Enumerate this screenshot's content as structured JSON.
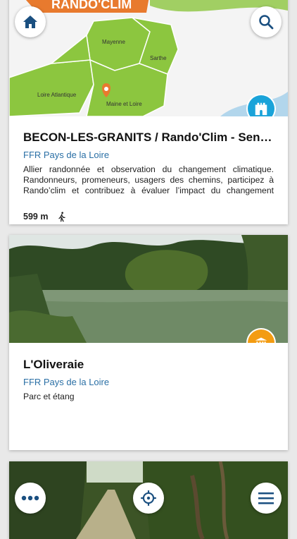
{
  "cards": [
    {
      "title": "BECON-LES-GRANITS / Rando'Clim - Senti…",
      "organization": "FFR Pays de la Loire",
      "description": "Allier randonnée et observation du changement climatique. Randonneurs, promeneurs, usagers des chemins, participez à Rando’clim et contribuez à évaluer l’impact du changement climatique",
      "distance": "599 m",
      "badge_icon": "castle-icon",
      "badge_color": "#1aa3d9",
      "map_labels": {
        "banner": "RANDO'CLIM",
        "mayenne": "Mayenne",
        "sarthe": "Sarthe",
        "loire_atlantique": "Loire Atlantique",
        "maine_et_loire": "Maine et Loire"
      }
    },
    {
      "title": "L'Oliveraie",
      "organization": "FFR Pays de la Loire",
      "description": "Parc et étang",
      "badge_icon": "museum-icon",
      "badge_color": "#f39c12"
    }
  ],
  "nav": {
    "home_icon": "home-icon",
    "search_icon": "search-icon",
    "more_icon": "more-icon",
    "locate_icon": "crosshair-icon",
    "menu_icon": "menu-icon"
  },
  "colors": {
    "accent": "#1a4f80",
    "link": "#2a6fa5"
  }
}
